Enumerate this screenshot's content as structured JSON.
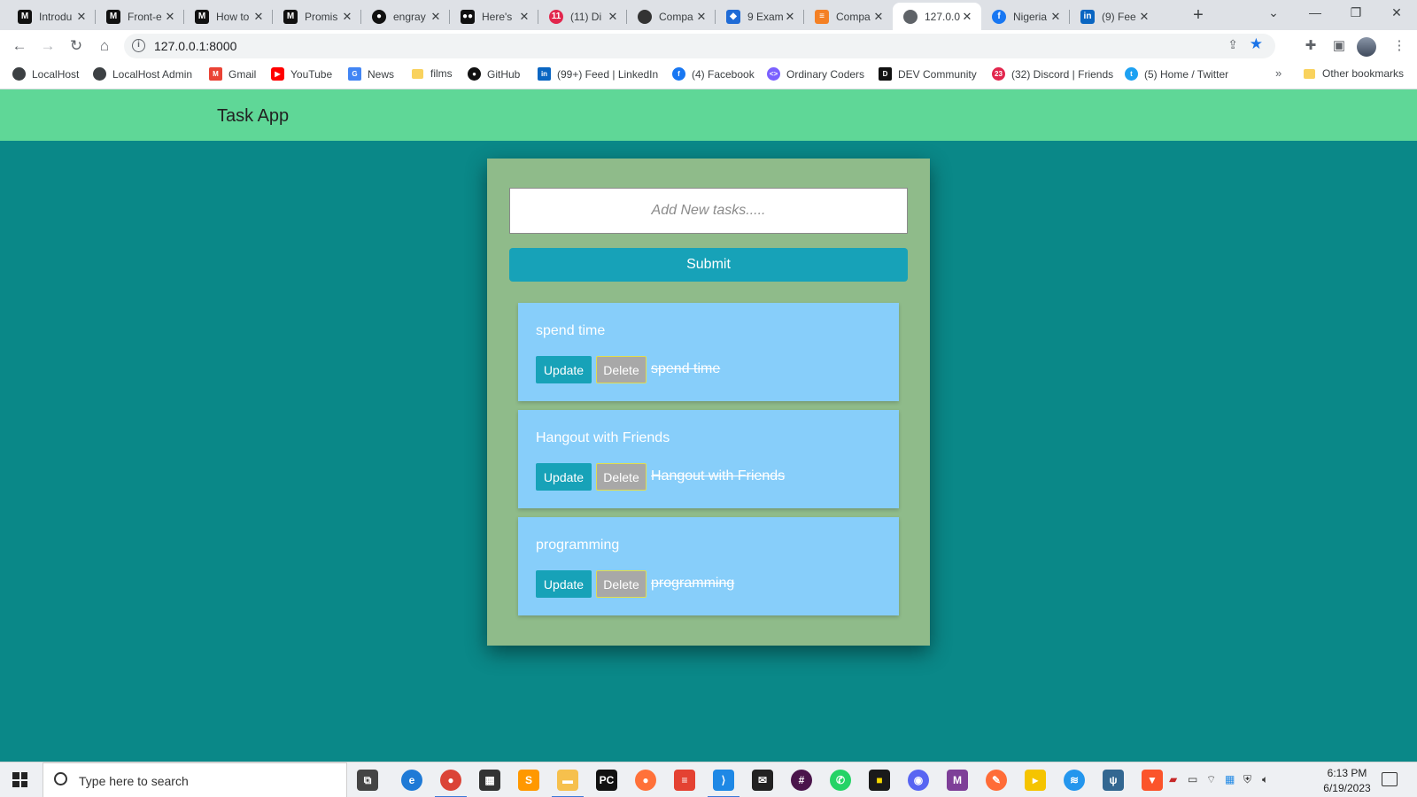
{
  "browser": {
    "tabs": [
      {
        "title": "Introdu",
        "icon": "medium-icon",
        "color": "#111111"
      },
      {
        "title": "Front-e",
        "icon": "medium-icon",
        "color": "#111111"
      },
      {
        "title": "How to",
        "icon": "medium-icon",
        "color": "#111111"
      },
      {
        "title": "Promis",
        "icon": "medium-icon",
        "color": "#111111"
      },
      {
        "title": "engray",
        "icon": "github-icon",
        "color": "#111111"
      },
      {
        "title": "Here's",
        "icon": "dev-icon",
        "color": "#111111"
      },
      {
        "title": "(11) Di",
        "icon": "discord-icon",
        "color": "#e2264d"
      },
      {
        "title": "Compa",
        "icon": "globe-icon",
        "color": "#333333"
      },
      {
        "title": "9 Exam",
        "icon": "app-icon",
        "color": "#1f6bd6"
      },
      {
        "title": "Compa",
        "icon": "stack-icon",
        "color": "#f48024"
      },
      {
        "title": "127.0.0",
        "icon": "globe-icon",
        "color": "#5f6368"
      },
      {
        "title": "Nigeria",
        "icon": "facebook-icon",
        "color": "#1877f2"
      },
      {
        "title": "(9) Fee",
        "icon": "linkedin-icon",
        "color": "#0a66c2"
      }
    ],
    "url": "127.0.0.1:8000",
    "bookmarks": [
      {
        "label": "LocalHost",
        "icon": "globe-icon",
        "color": "#3c4043"
      },
      {
        "label": "LocalHost Admin",
        "icon": "globe-icon",
        "color": "#3c4043"
      },
      {
        "label": "Gmail",
        "icon": "gmail-icon",
        "color": "#ea4335"
      },
      {
        "label": "YouTube",
        "icon": "youtube-icon",
        "color": "#ff0000"
      },
      {
        "label": "News",
        "icon": "news-icon",
        "color": "#4285f4"
      },
      {
        "label": "films",
        "icon": "folder-icon",
        "color": "#f9d25d"
      },
      {
        "label": "GitHub",
        "icon": "github-icon",
        "color": "#111111"
      },
      {
        "label": "(99+) Feed | LinkedIn",
        "icon": "linkedin-icon",
        "color": "#0a66c2"
      },
      {
        "label": "(4) Facebook",
        "icon": "facebook-icon",
        "color": "#1877f2"
      },
      {
        "label": "Ordinary Coders",
        "icon": "code-icon",
        "color": "#7b61ff"
      },
      {
        "label": "DEV Community",
        "icon": "dev-icon",
        "color": "#111111"
      },
      {
        "label": "(32) Discord | Friends",
        "icon": "discord-icon",
        "color": "#e2264d"
      },
      {
        "label": "(5) Home / Twitter",
        "icon": "twitter-icon",
        "color": "#1da1f2"
      }
    ],
    "other_bookmarks": "Other bookmarks"
  },
  "app": {
    "brand": "Task App",
    "input_placeholder": "Add New tasks.....",
    "submit_label": "Submit",
    "update_label": "Update",
    "delete_label": "Delete",
    "tasks": [
      {
        "title": "spend time"
      },
      {
        "title": "Hangout with Friends"
      },
      {
        "title": "programming"
      }
    ]
  },
  "taskbar": {
    "search_placeholder": "Type here to search",
    "time": "6:13 PM",
    "date": "6/19/2023"
  },
  "colors": {
    "page_background": "#0a8888",
    "navbar": "#5fd797",
    "panel": "#8fbb8a",
    "task_item": "#87cefa",
    "button": "#17a2b8",
    "delete_button": "#a8a8a8"
  }
}
